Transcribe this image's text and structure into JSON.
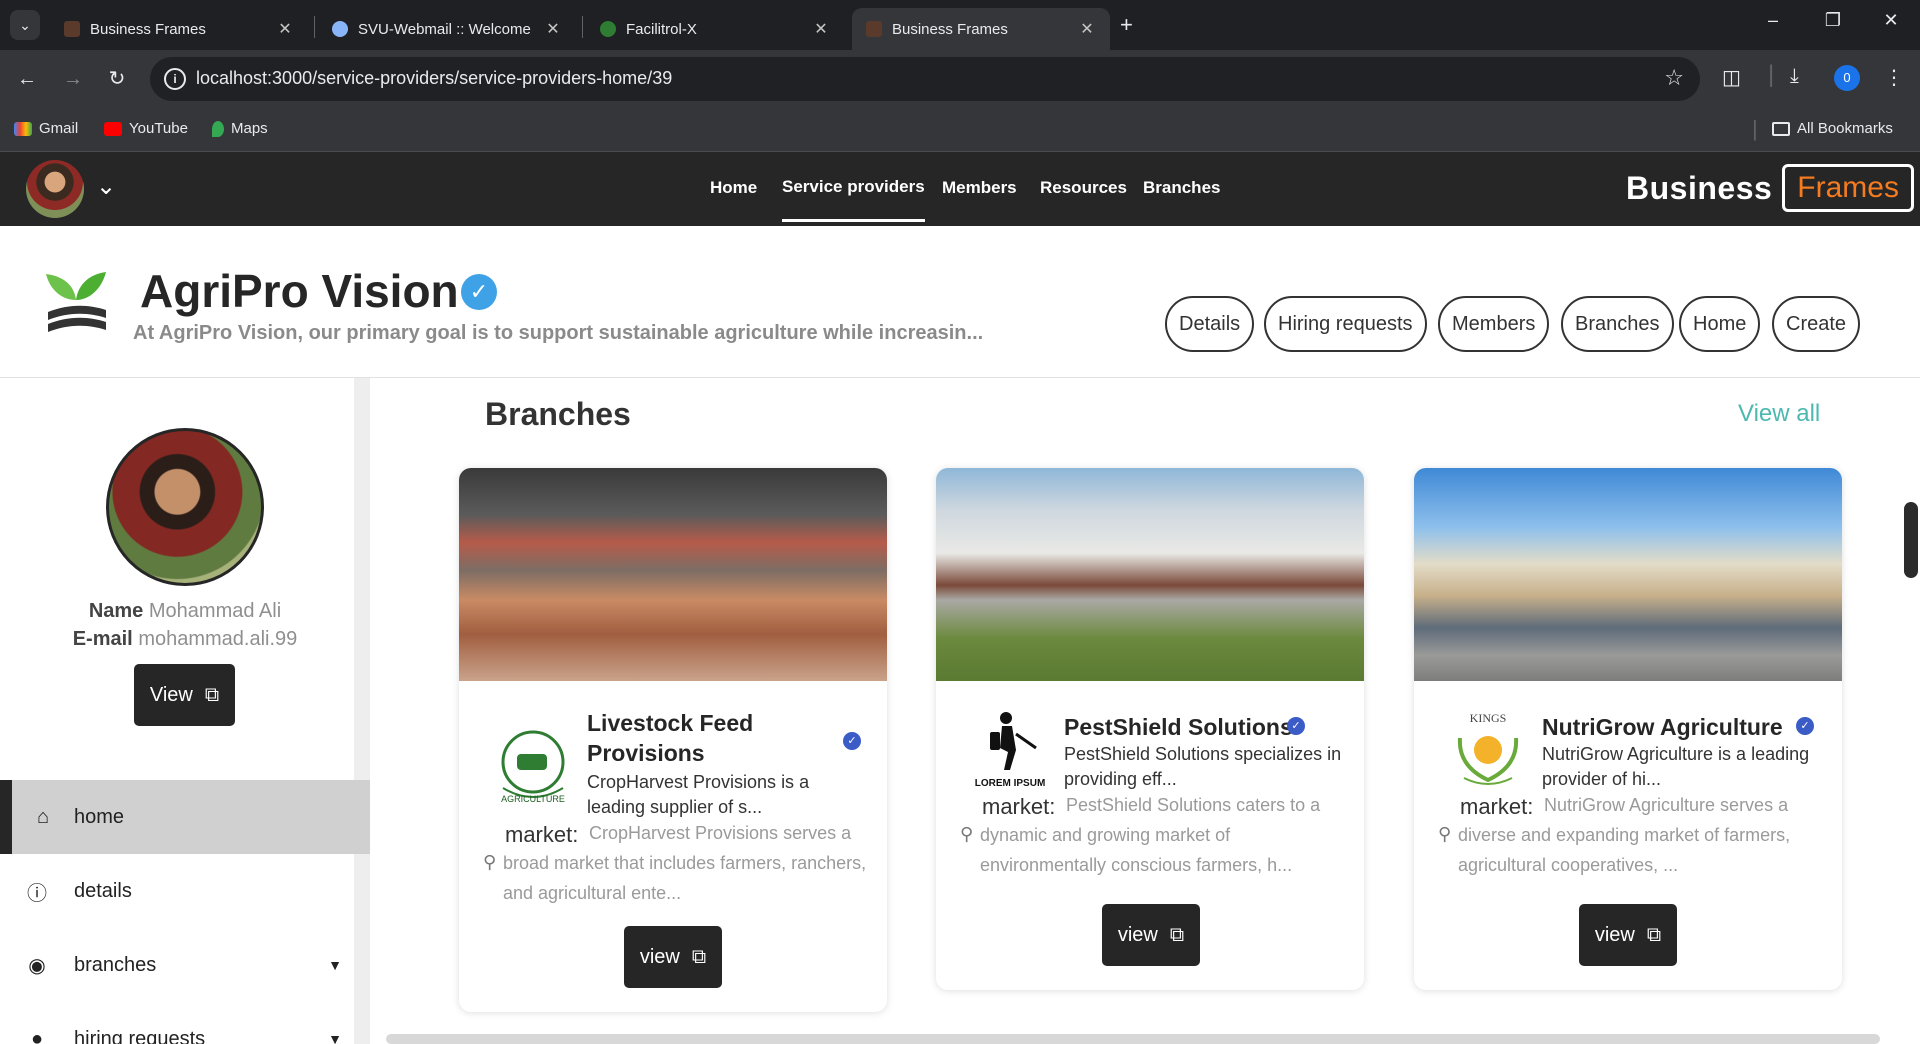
{
  "browser": {
    "tabs": [
      {
        "title": "Business Frames",
        "active": false
      },
      {
        "title": "SVU-Webmail :: Welcome",
        "active": false
      },
      {
        "title": "Facilitrol-X",
        "active": false
      },
      {
        "title": "Business Frames",
        "active": true
      }
    ],
    "url": "localhost:3000/service-providers/service-providers-home/39",
    "profile_initial": "0",
    "bookmarks": [
      "Gmail",
      "YouTube",
      "Maps"
    ],
    "all_bookmarks": "All Bookmarks"
  },
  "app_nav": {
    "links": [
      "Home",
      "Service providers",
      "Members",
      "Resources",
      "Branches"
    ],
    "active_link": "Service providers",
    "brand_main": "Business",
    "brand_box": "Frames",
    "brand_color": "#f47b20"
  },
  "company": {
    "name": "AgriPro Vision",
    "tagline": "At AgriPro Vision, our primary goal is to support sustainable agriculture while increasin...",
    "actions": [
      "Details",
      "Hiring requests",
      "Members",
      "Branches",
      "Home",
      "Create"
    ]
  },
  "sidebar": {
    "name_label": "Name",
    "name_value": "Mohammad Ali",
    "email_label": "E-mail",
    "email_value": "mohammad.ali.99",
    "view_label": "View",
    "menu": [
      {
        "label": "home",
        "icon": "home-icon",
        "active": true
      },
      {
        "label": "details",
        "icon": "info-icon",
        "active": false
      },
      {
        "label": "branches",
        "icon": "location-pin-icon",
        "active": false
      },
      {
        "label": "hiring requests",
        "icon": "dot-icon",
        "active": false
      }
    ]
  },
  "branches": {
    "title": "Branches",
    "view_all": "View all",
    "cards": [
      {
        "title": "Livestock Feed Provisions",
        "description": "CropHarvest Provisions is a leading supplier of s...",
        "market_label": "market:",
        "market_text": "CropHarvest Provisions serves a broad market that includes farmers, ranchers, and agricultural ente...",
        "button": "view",
        "logo_text": "AGRICULTURE"
      },
      {
        "title": "PestShield Solutions",
        "description": "PestShield Solutions specializes in providing eff...",
        "market_label": "market:",
        "market_text": "PestShield Solutions caters to a dynamic and growing market of environmentally conscious farmers, h...",
        "button": "view",
        "logo_text": "LOREM IPSUM"
      },
      {
        "title": "NutriGrow Agriculture",
        "description": "NutriGrow Agriculture is a leading provider of hi...",
        "market_label": "market:",
        "market_text": "NutriGrow Agriculture serves a diverse and expanding market of farmers, agricultural cooperatives, ...",
        "button": "view",
        "logo_text": "KINGS"
      }
    ]
  }
}
